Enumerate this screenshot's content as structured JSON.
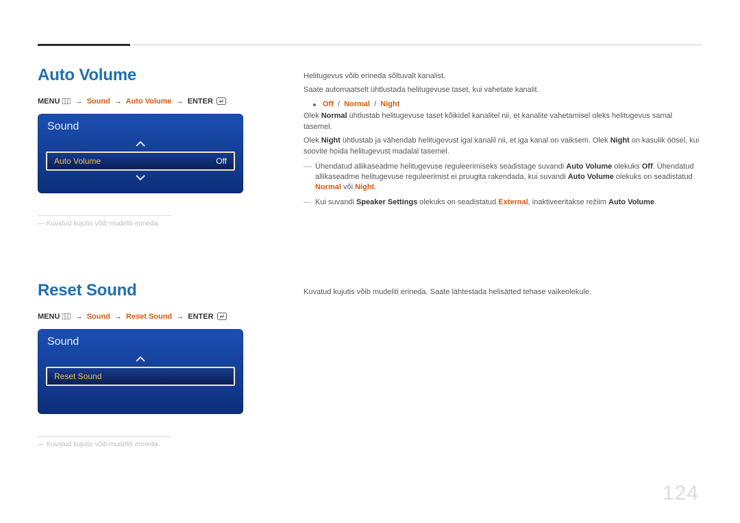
{
  "pageNumber": "124",
  "section1": {
    "heading": "Auto Volume",
    "breadcrumb": {
      "menu": "MENU",
      "path1": "Sound",
      "path2": "Auto Volume",
      "enter": "ENTER"
    },
    "osd": {
      "title": "Sound",
      "selectedLabel": "Auto Volume",
      "selectedValue": "Off"
    },
    "footnote": "Kuvatud kujutis võib mudeliti erineda.",
    "right": {
      "p1": "Helitugevus võib erineda sõltuvalt kanalist.",
      "p2": "Saate automaatselt ühtlustada helitugevuse taset, kui vahetate kanalit.",
      "options": {
        "o1": "Off",
        "o2": "Normal",
        "o3": "Night"
      },
      "p3_pre": "Olek ",
      "p3_normal": "Normal",
      "p3_post": " ühtlustab helitugevuse taset kõikidel kanalitel nii, et kanalite vahetamisel oleks helitugevus samal tasemel.",
      "p4_pre": "Olek ",
      "p4_night1": "Night",
      "p4_mid": " ühtlustab ja vähendab helitugevust igal kanalil nii, et iga kanal on vaiksem. Olek ",
      "p4_night2": "Night",
      "p4_post": " on kasulik öösel, kui soovite hoida helitugevust madalal tasemel.",
      "note1_a": "Ühendatud allikaseadme helitugevuse reguleerimiseks seadistage suvandi ",
      "note1_b": "Auto Volume",
      "note1_c": " olekuks ",
      "note1_d": "Off",
      "note1_e": ". Ühendatud allikaseadme helitugevuse reguleerimist ei pruugita rakendada, kui suvandi ",
      "note1_f": "Auto Volume",
      "note1_g": " olekuks on seadistatud ",
      "note1_h": "Normal",
      "note1_i": " või ",
      "note1_j": "Night",
      "note1_k": ".",
      "note2_a": "Kui suvandi ",
      "note2_b": "Speaker Settings",
      "note2_c": " olekuks on seadistatud ",
      "note2_d": "External",
      "note2_e": ", inaktiveeritakse režiim ",
      "note2_f": "Auto Volume",
      "note2_g": "."
    }
  },
  "section2": {
    "heading": "Reset Sound",
    "breadcrumb": {
      "menu": "MENU",
      "path1": "Sound",
      "path2": "Reset Sound",
      "enter": "ENTER"
    },
    "osd": {
      "title": "Sound",
      "selectedLabel": "Reset Sound"
    },
    "footnote": "Kuvatud kujutis võib mudeliti erineda.",
    "right": {
      "p1": "Kuvatud kujutis võib mudeliti erineda. Saate lähtestada helisätted tehase vaikeolekule."
    }
  }
}
